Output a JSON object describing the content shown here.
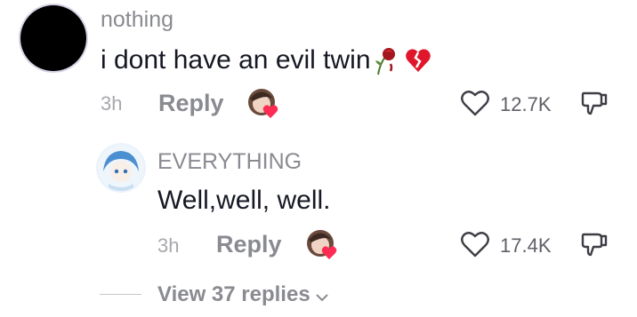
{
  "comment": {
    "username": "nothing",
    "text": "i dont have an evil twin",
    "emojis": [
      "wilted-rose",
      "broken-heart"
    ],
    "time": "3h",
    "reply_label": "Reply",
    "likes": "12.7K",
    "avatar_color": "#000000"
  },
  "reply": {
    "username": "EVERYTHING",
    "text": "Well,well, well.",
    "time": "3h",
    "reply_label": "Reply",
    "likes": "17.4K"
  },
  "view_replies": "View 37 replies",
  "colors": {
    "text": "#161823",
    "muted": "#8a8b91",
    "heart": "#fe2c55"
  }
}
